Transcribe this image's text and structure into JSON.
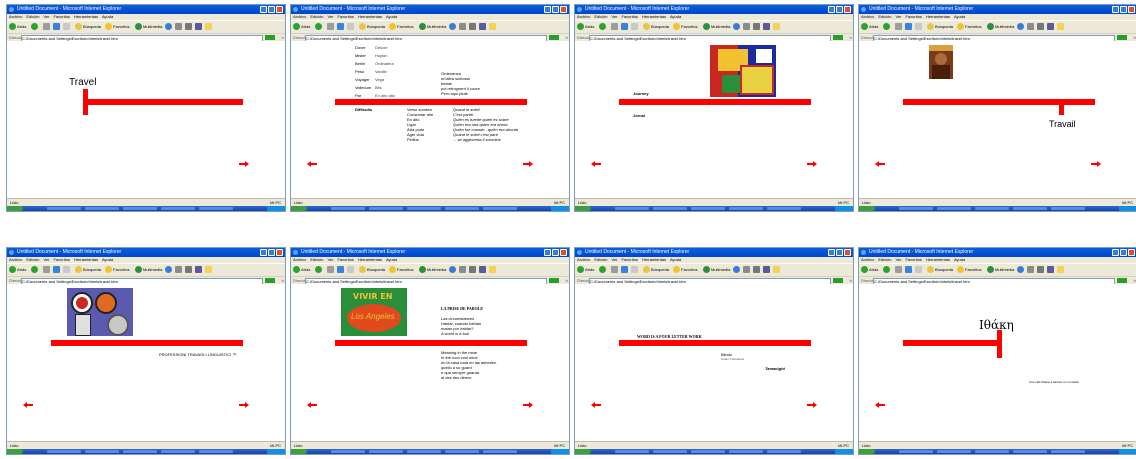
{
  "browser": {
    "title": "Untitled Document - Microsoft Internet Explorer",
    "menu": [
      "Archivo",
      "Edición",
      "Ver",
      "Favoritos",
      "Herramientas",
      "Ayuda"
    ],
    "toolbar": {
      "back": "Atrás",
      "search": "Búsqueda",
      "favorites": "Favoritos",
      "media": "Multimedia"
    },
    "address_label": "Dirección",
    "address": "C:\\Documents and Settings\\Escritorio\\htmls\\travel.htm",
    "go_label": "Ir",
    "status_done": "Listo",
    "status_zone": "Mi PC",
    "colors": {
      "title_bar": "#0046c8",
      "chrome": "#ece9d8",
      "accent_red": "#ff0000",
      "taskbar": "#245edb"
    }
  },
  "panels": {
    "p1": {
      "word": "Travel"
    },
    "p2": {
      "pairs": [
        {
          "a": "Dover",
          "b": "Deluxe"
        },
        {
          "a": "Mister",
          "b": "Hopkin"
        },
        {
          "a": "Berlin",
          "b": "Ordinateur"
        },
        {
          "a": "Peso",
          "b": "Vanille"
        },
        {
          "a": "Voyager",
          "b": "Vega"
        },
        {
          "a": "Vallecum",
          "b": "Bits"
        },
        {
          "a": "Par",
          "b": "En alto alto"
        }
      ],
      "right_block": "Ordenanza\nun'altra scelosta\nbelate\npol retrognerri il cuore\nPero aqui plote",
      "bottom_head": "Difficults",
      "bottom_list": "Verso sombra\nConsumar ahe\nEn alto\nLigar\nAtrà pode\nAger vida\nPelllus",
      "bottom_italic": "Quand le soleil\nC'est partiti\nQuién es fuente quién es sobre\nQuien era una quien era ahora\nQuién fue cuando , quién era ahorab\nQuand le soleil c'est parti\n... se aggiocerta il sororline"
    },
    "p3": {
      "labels": [
        "Journey",
        "Jornal"
      ]
    },
    "p4": {
      "word": "Travail"
    },
    "p5": {
      "caption": "PROFESSIONI TRAVAGLI LINGUISTICI ™"
    },
    "p6": {
      "badge_title": "VIVIR EN",
      "badge_script": "Los Angeles",
      "heading": "LA PRISE DE PAROLE",
      "upper": "Las circumstances\nHablar, cuando hablan\nmatan por hablar?\nA world is a tool",
      "lower": "Meaning in the mine\nIn the cool cool mine\nen la casa toda en las almerien\nquello a so guard\ne qua sempre guarda\nal des des dinero"
    },
    "p7": {
      "heading": "WORD IS A FOUR LETTER WORK",
      "sub": "Blindz",
      "sub2": "Celan Corbiantes",
      "italic": "Tamacight"
    },
    "p8": {
      "word": "Ιθάκη",
      "small": "Une ville Ithake a partout un un favart"
    }
  }
}
